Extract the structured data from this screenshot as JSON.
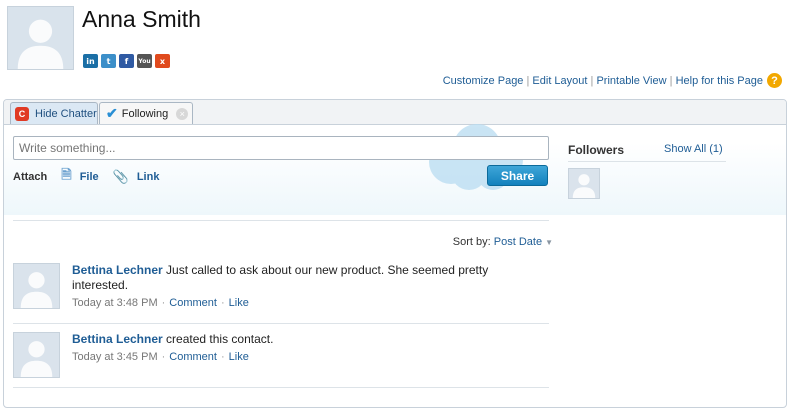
{
  "profile": {
    "name": "Anna Smith",
    "social": [
      {
        "name": "linkedin-icon",
        "glyph": "in"
      },
      {
        "name": "twitter-icon",
        "glyph": "t"
      },
      {
        "name": "facebook-icon",
        "glyph": "f"
      },
      {
        "name": "youtube-icon",
        "glyph": "You"
      },
      {
        "name": "xing-icon",
        "glyph": "x"
      }
    ]
  },
  "toplinks": {
    "customize": "Customize Page",
    "edit_layout": "Edit Layout",
    "printable": "Printable View",
    "help": "Help for this Page",
    "separator": "|",
    "help_icon": "?"
  },
  "tabs": {
    "hide_chatter": "Hide Chatter",
    "following": "Following"
  },
  "publisher": {
    "placeholder": "Write something...",
    "attach_label": "Attach",
    "file_label": "File",
    "link_label": "Link",
    "share_label": "Share"
  },
  "sort": {
    "label": "Sort by:",
    "value": "Post Date"
  },
  "feed": [
    {
      "author": "Bettina Lechner",
      "text": "Just called to ask about our new product. She seemed pretty interested.",
      "time": "Today at 3:48 PM",
      "comment": "Comment",
      "like": "Like",
      "dot": "·"
    },
    {
      "author": "Bettina Lechner",
      "text": "created this contact.",
      "time": "Today at 3:45 PM",
      "comment": "Comment",
      "like": "Like",
      "dot": "·"
    }
  ],
  "followers": {
    "title": "Followers",
    "show_all": "Show All (1)"
  },
  "colors": {
    "link": "#1f5d95",
    "share_button": "#1381bd",
    "chatter_icon": "#e03a24",
    "help_icon": "#f2a800"
  }
}
